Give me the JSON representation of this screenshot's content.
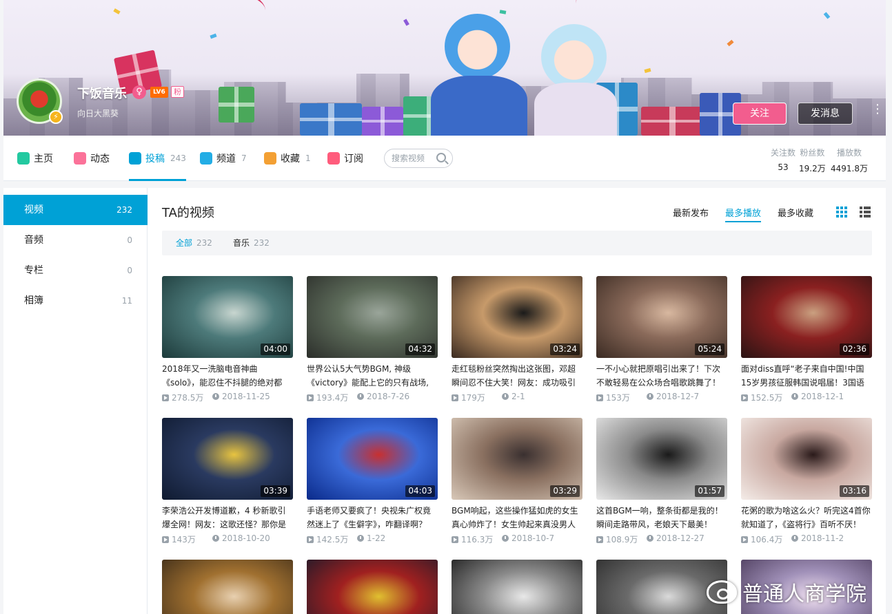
{
  "profile": {
    "name": "下饭音乐",
    "gender_symbol": "♀",
    "level": "LV6",
    "fan_badge": "粉",
    "sign": "向日大黑葵",
    "avatar_badge": "⚡",
    "follow_label": "关注",
    "message_label": "发消息",
    "more_symbol": "⋮"
  },
  "nav": {
    "items": [
      {
        "label": "主页",
        "count": "",
        "icon_color": "#23c9a0"
      },
      {
        "label": "动态",
        "count": "",
        "icon_color": "#fb7299"
      },
      {
        "label": "投稿",
        "count": "243",
        "icon_color": "#00a1d6"
      },
      {
        "label": "频道",
        "count": "7",
        "icon_color": "#23ade5"
      },
      {
        "label": "收藏",
        "count": "1",
        "icon_color": "#f3a034"
      },
      {
        "label": "订阅",
        "count": "",
        "icon_color": "#ff5c7c"
      }
    ],
    "active_index": 2,
    "search_placeholder": "搜索视频",
    "stats": [
      {
        "label": "关注数",
        "value": "53"
      },
      {
        "label": "粉丝数",
        "value": "19.2万"
      },
      {
        "label": "播放数",
        "value": "4491.8万"
      }
    ]
  },
  "sidebar": {
    "items": [
      {
        "label": "视频",
        "count": "232"
      },
      {
        "label": "音频",
        "count": "0"
      },
      {
        "label": "专栏",
        "count": "0"
      },
      {
        "label": "相簿",
        "count": "11"
      }
    ]
  },
  "main": {
    "title": "TA的视频",
    "sort_options": [
      "最新发布",
      "最多播放",
      "最多收藏"
    ],
    "active_sort": 1,
    "filters": [
      {
        "label": "全部",
        "count": "232"
      },
      {
        "label": "音乐",
        "count": "232"
      }
    ],
    "videos": [
      {
        "title": "2018年又一洗脑电音神曲《solo》，能忍住不抖腿的绝对都",
        "duration": "04:00",
        "plays": "278.5万",
        "date": "2018-11-25",
        "colors": [
          "#1c3a3a",
          "#4d7a7a",
          "#c8d6d0"
        ]
      },
      {
        "title": "世界公认5大气势BGM, 神级《victory》能配上它的只有战场, 听",
        "duration": "04:32",
        "plays": "193.4万",
        "date": "2018-7-26",
        "colors": [
          "#2b2e2a",
          "#5d6b5a",
          "#9aa59a"
        ]
      },
      {
        "title": "走红毯粉丝突然掏出这张图，邓超瞬间忍不住大笑！网友：成功吸引",
        "duration": "03:24",
        "plays": "179万",
        "date": "2-1",
        "colors": [
          "#3a2a20",
          "#c79a6a",
          "#1a1a1a"
        ]
      },
      {
        "title": "一不小心就把原唱引出来了！下次不敢轻易在公众场合唱歌跳舞了！",
        "duration": "05:24",
        "plays": "153万",
        "date": "2018-12-7",
        "colors": [
          "#3a2a22",
          "#8a6a5a",
          "#d8b8a0"
        ]
      },
      {
        "title": "面对diss直呼“老子来自中国!中国15岁男孩征服韩国说唱届！3国语言",
        "duration": "02:36",
        "plays": "152.5万",
        "date": "2018-12-1",
        "colors": [
          "#2a1414",
          "#8a2020",
          "#caa080"
        ]
      },
      {
        "title": "李荣浩公开发博道歉，4 秒新歌引爆全网！网友：这歌还怪？那你是",
        "duration": "03:39",
        "plays": "143万",
        "date": "2018-10-20",
        "colors": [
          "#0f1a30",
          "#2a3a60",
          "#e8c440"
        ]
      },
      {
        "title": "手语老师又要疯了！央视朱广权竟然迷上了《生僻字》，咋翻译啊？",
        "duration": "04:03",
        "plays": "142.5万",
        "date": "1-22",
        "colors": [
          "#0a2a8a",
          "#3a6ad8",
          "#c83030"
        ]
      },
      {
        "title": "BGM响起，这些操作猛如虎的女生真心帅炸了！女生帅起来真没男人",
        "duration": "03:29",
        "plays": "116.3万",
        "date": "2018-10-7",
        "colors": [
          "#d8c8b8",
          "#8a7060",
          "#3a3030"
        ]
      },
      {
        "title": "这首BGM一响，整条街都是我的！瞬间走路带风，老娘天下最美！",
        "duration": "01:57",
        "plays": "108.9万",
        "date": "2018-12-27",
        "colors": [
          "#e8e8e8",
          "#8a8a8a",
          "#1a1a1a"
        ]
      },
      {
        "title": "花粥的歌为啥这么火？听完这4首你就知道了，《盗将行》百听不厌！",
        "duration": "03:16",
        "plays": "106.4万",
        "date": "2018-11-2",
        "colors": [
          "#f4ece8",
          "#c8a8a0",
          "#2a1a1a"
        ]
      },
      {
        "title": "",
        "duration": "",
        "plays": "",
        "date": "",
        "colors": [
          "#3a2a18",
          "#a07030",
          "#e8d0b0"
        ]
      },
      {
        "title": "",
        "duration": "",
        "plays": "",
        "date": "",
        "colors": [
          "#1a1a2a",
          "#a02020",
          "#e0c030"
        ]
      },
      {
        "title": "",
        "duration": "",
        "plays": "",
        "date": "",
        "colors": [
          "#1a1a1a",
          "#8a8a8a",
          "#e8e8e8"
        ]
      },
      {
        "title": "",
        "duration": "",
        "plays": "",
        "date": "",
        "colors": [
          "#2a2a2a",
          "#6a6a6a",
          "#dadada"
        ]
      },
      {
        "title": "",
        "duration": "",
        "plays": "",
        "date": "",
        "colors": [
          "#4a3a5a",
          "#a090b8",
          "#f0e0f0"
        ]
      }
    ]
  },
  "watermark": "普通人商学院",
  "colors": {
    "accent": "#00a1d6",
    "pink": "#f25d8e"
  }
}
